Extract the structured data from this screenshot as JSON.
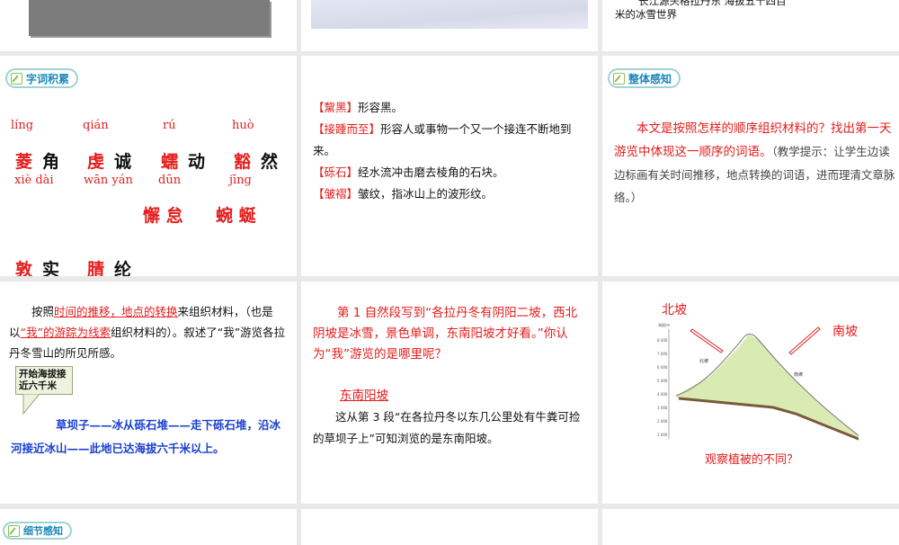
{
  "slides": {
    "s1": {},
    "s2": {},
    "s3": {
      "caption_line1": "长江源头格拉丹东 海拔五十四百",
      "caption_line2": "米的冰雪世界"
    },
    "s4": {
      "badge": "字词积累",
      "pinyin_row1": [
        "líng",
        "qián",
        "rú",
        "huò"
      ],
      "words_row1": [
        {
          "r": "菱",
          "b": "角"
        },
        {
          "r": "虔",
          "b": "诚"
        },
        {
          "r": "蠕",
          "b": "动"
        },
        {
          "r": "豁",
          "b": "然"
        }
      ],
      "pinyin_row2": [
        "xiè dài",
        "wān yán",
        "dūn",
        "jīng"
      ],
      "words_row2": [
        "懈 怠",
        "蜿 蜒"
      ],
      "words_row3": [
        {
          "r": "敦",
          "b": "实"
        },
        {
          "r": "腈",
          "b": "纶"
        }
      ]
    },
    "s5": {
      "items": [
        {
          "term": "【黧黑】",
          "def": "形容黑。"
        },
        {
          "term": "【接踵而至】",
          "def": "形容人或事物一个又一个接连不断地到来。"
        },
        {
          "term": "【砾石】",
          "def": "经水流冲击磨去棱角的石块。"
        },
        {
          "term": "【皱褶】",
          "def": "皱纹，指冰山上的波形纹。"
        }
      ]
    },
    "s6": {
      "badge": "整体感知",
      "question": "本文是按照怎样的顺序组织材料的？找出第一天游览中体现这一顺序的词语。",
      "hint": "（教学提示：让学生边读边标画有关时间推移，地点转换的词语，进而理清文章脉络。）"
    },
    "s7": {
      "p1_a": "按照",
      "p1_u": "时间的推移，地点的转换",
      "p1_b": "来组织材料，（也是以",
      "p1_u2": "“我”的游踪为线索",
      "p1_c": "组织材料的）。叙述了“我”游览各拉丹冬雪山的所见所感。",
      "callout": "开始海拔接近六千米",
      "route": "草坝子——冰从砾石堆——走下砾石堆，沿冰河接近冰山——此地已达海拔六千米以上。"
    },
    "s8": {
      "question": "第 1 自然段写到“各拉丹冬有阴阳二坡，西北阴坡是冰雪，景色单调，东南阳坡才好看。”你认为“我”游览的是哪里呢？",
      "answer": "东南阳坡",
      "explain": "这从第 3 段“在各拉丹冬以东几公里处有牛粪可捡的草坝子上”可知浏览的是东南阳坡。"
    },
    "s9": {
      "north": "北坡",
      "south": "南坡",
      "caption": "观察植被的不同？",
      "axis_title": "海拔/m",
      "ticks": [
        "8 000",
        "7 000",
        "6 000",
        "5 000",
        "4 000",
        "3 000",
        "2 000",
        "1 000"
      ],
      "north_label": "北坡",
      "south_label": "南坡"
    },
    "s10": {
      "badge": "细节感知"
    }
  }
}
